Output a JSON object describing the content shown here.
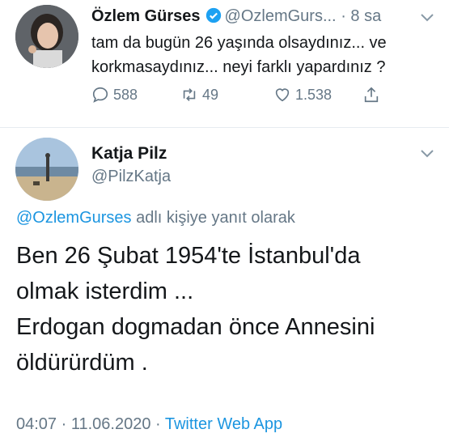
{
  "tweet1": {
    "author_name": "Özlem Gürses",
    "handle": "@OzlemGurs...",
    "time": "· 8 sa",
    "text": "tam da bugün 26 yaşında olsaydınız... ve korkmasaydınız... neyi farklı yapardınız ?",
    "replies": "588",
    "retweets": "49",
    "likes": "1.538"
  },
  "tweet2": {
    "author_name": "Katja Pilz",
    "handle": "@PilzKatja",
    "reply_to_handle": "@OzlemGurses",
    "reply_to_suffix": " adlı kişiye yanıt olarak",
    "lines": [
      "Ben 26 Şubat 1954'te İstanbul'da",
      "olmak isterdim ...",
      "Erdogan dogmadan önce Annesini",
      "öldürürdüm ."
    ],
    "timestamp": "04:07 · 11.06.2020 · ",
    "source_app": "Twitter Web App"
  },
  "colors": {
    "accent": "#1b95e0",
    "muted": "#657786",
    "text": "#14171a"
  }
}
